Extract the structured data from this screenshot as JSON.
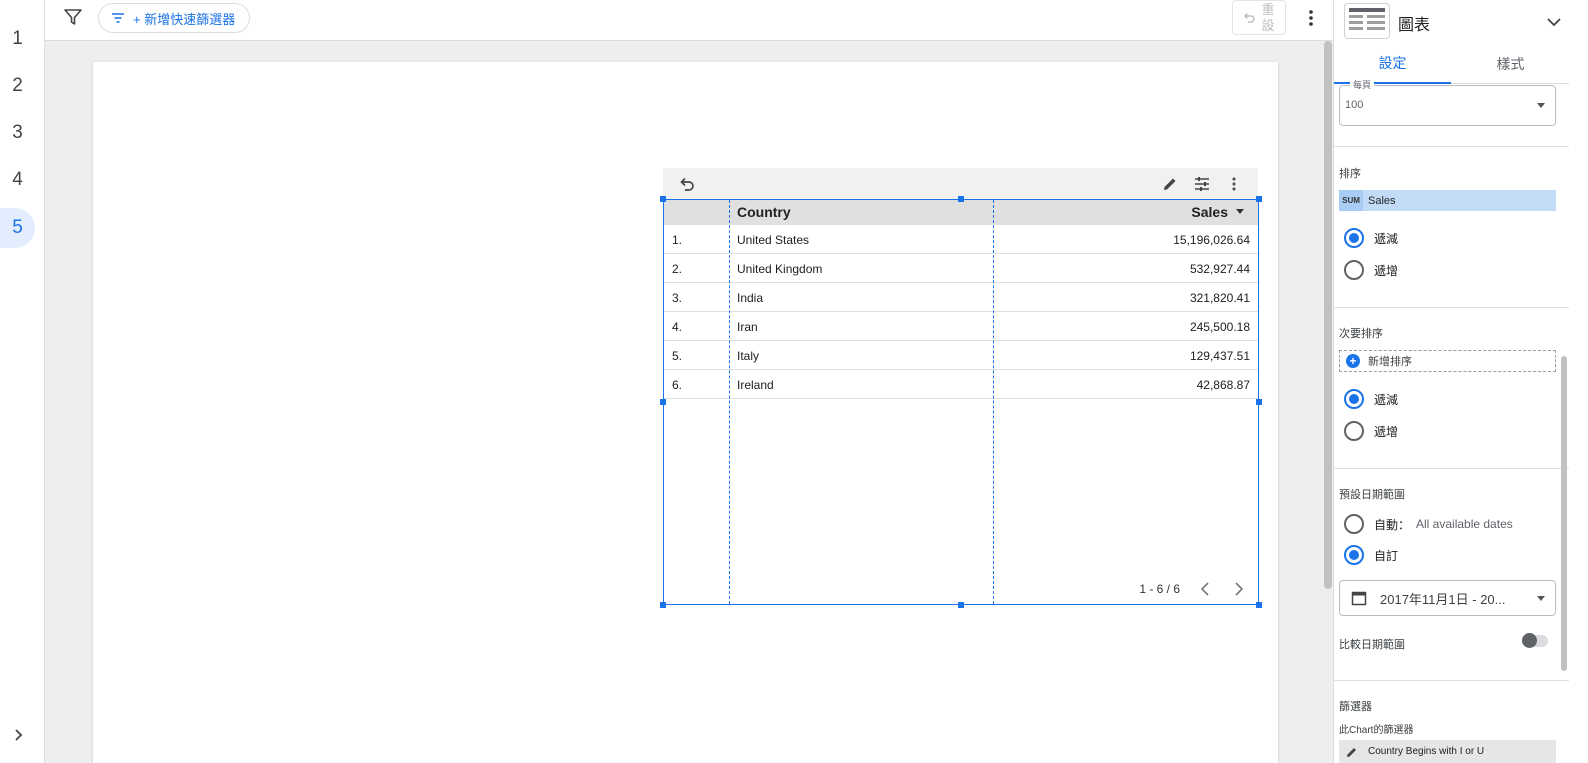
{
  "rail": {
    "pages": [
      "1",
      "2",
      "3",
      "4",
      "5"
    ],
    "active_page": "5"
  },
  "toolbar": {
    "add_quick_filter": "+ 新增快速篩選器",
    "reset_label": "重設"
  },
  "table": {
    "headers": {
      "country": "Country",
      "sales": "Sales"
    },
    "rows": [
      {
        "idx": "1.",
        "country": "United States",
        "sales": "15,196,026.64"
      },
      {
        "idx": "2.",
        "country": "United Kingdom",
        "sales": "532,927.44"
      },
      {
        "idx": "3.",
        "country": "India",
        "sales": "321,820.41"
      },
      {
        "idx": "4.",
        "country": "Iran",
        "sales": "245,500.18"
      },
      {
        "idx": "5.",
        "country": "Italy",
        "sales": "129,437.51"
      },
      {
        "idx": "6.",
        "country": "Ireland",
        "sales": "42,868.87"
      }
    ],
    "pagination": "1 - 6 / 6"
  },
  "panel": {
    "title": "圖表",
    "tabs": {
      "setup": "設定",
      "style": "樣式"
    },
    "rows_per_page": {
      "label": "每頁",
      "value": "100"
    },
    "sort": {
      "title": "排序",
      "chip_agg": "SUM",
      "chip_field": "Sales",
      "desc": "遞減",
      "asc": "遞增"
    },
    "secondary_sort": {
      "title": "次要排序",
      "add": "新增排序",
      "desc": "遞減",
      "asc": "遞增"
    },
    "date_range": {
      "title": "預設日期範圍",
      "auto": "自動：",
      "auto_hint": "All available dates",
      "custom": "自訂",
      "value": "2017年11月1日 - 20..."
    },
    "compare": {
      "label": "比較日期範圍"
    },
    "filters": {
      "title": "篩選器",
      "subtitle": "此Chart的篩選器",
      "chip": "Country Begins with I or U"
    }
  },
  "colors": {
    "accent": "#1a73e8",
    "sort_chip": "#c2dcf8"
  }
}
